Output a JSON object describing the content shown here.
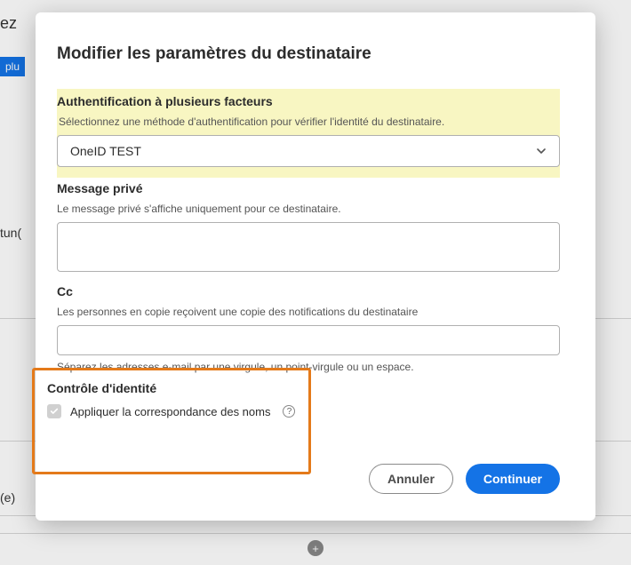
{
  "backdrop": {
    "ez": "ez",
    "plu": "plu",
    "tun": "tun(",
    "e": "(e)"
  },
  "modal": {
    "title": "Modifier les paramètres du destinataire",
    "mfa": {
      "heading": "Authentification à plusieurs facteurs",
      "hint": "Sélectionnez une méthode d'authentification pour vérifier l'identité du destinataire.",
      "selected": "OneID TEST"
    },
    "privateMessage": {
      "heading": "Message privé",
      "hint": "Le message privé s'affiche uniquement pour ce destinataire.",
      "value": ""
    },
    "cc": {
      "heading": "Cc",
      "hint": "Les personnes en copie reçoivent une copie des notifications du destinataire",
      "value": "",
      "belowHint": "Séparez les adresses e-mail par une virgule, un point-virgule ou un espace."
    },
    "identity": {
      "heading": "Contrôle d'identité",
      "checkboxLabel": "Appliquer la correspondance des noms",
      "checked": true
    },
    "buttons": {
      "cancel": "Annuler",
      "continue": "Continuer"
    }
  }
}
